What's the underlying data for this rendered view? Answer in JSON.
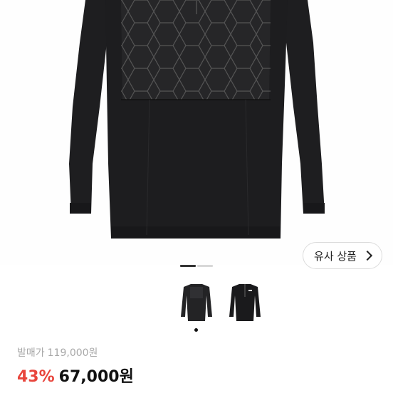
{
  "product": {
    "similar_button_label": "유사 상품",
    "original_price_label": "발매가",
    "original_price": "119,000원",
    "discount_percent": "43%",
    "sale_price": "67,000원"
  },
  "gallery": {
    "current_index": 1,
    "total": 2,
    "thumbnail_count": 2,
    "selected_thumbnail": 1
  },
  "colors": {
    "discount": "#e8453c",
    "garment": "#1f1f21"
  },
  "icons": {
    "similar_chevron": "chevron-right-icon"
  }
}
